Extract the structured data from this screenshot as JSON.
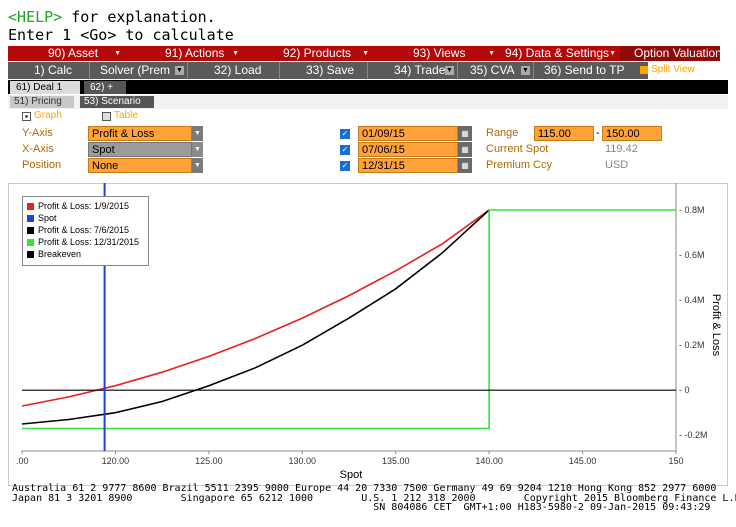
{
  "command": {
    "help_key": "<HELP>",
    "help_text": " for explanation.",
    "line2": "Enter 1 <Go> to calculate"
  },
  "menu": [
    {
      "label": "90) Asset"
    },
    {
      "label": "91) Actions"
    },
    {
      "label": "92) Products"
    },
    {
      "label": "93) Views"
    },
    {
      "label": "94) Data & Settings"
    },
    {
      "label": "Option Valuation"
    }
  ],
  "toolbar": [
    {
      "label": "1) Calc"
    },
    {
      "label": "Solver (Prem"
    },
    {
      "label": "32) Load"
    },
    {
      "label": "33) Save"
    },
    {
      "label": "34) Trade"
    },
    {
      "label": "35) CVA"
    },
    {
      "label": "36) Send to TP"
    }
  ],
  "split_view": "Split View",
  "deal_tabs": [
    {
      "label": "61) Deal 1"
    },
    {
      "label": "62) +"
    }
  ],
  "sub_tabs": [
    {
      "label": "51) Pricing"
    },
    {
      "label": "53) Scenario"
    }
  ],
  "view_mode": {
    "graph": "Graph",
    "table": "Table"
  },
  "form": {
    "y_axis": {
      "label": "Y-Axis",
      "value": "Profit & Loss"
    },
    "x_axis": {
      "label": "X-Axis",
      "value": "Spot"
    },
    "position": {
      "label": "Position",
      "value": "None"
    },
    "dates": [
      "01/09/15",
      "07/06/15",
      "12/31/15"
    ],
    "range": {
      "label": "Range",
      "from": "115.00",
      "to": "150.00"
    },
    "current_spot": {
      "label": "Current Spot",
      "value": "119.42"
    },
    "premium_ccy": {
      "label": "Premium Ccy",
      "value": "USD"
    }
  },
  "chart_data": {
    "type": "line",
    "xlabel": "Spot",
    "ylabel": "Profit & Loss",
    "xlim": [
      115,
      150
    ],
    "ylim": [
      -0.27,
      0.92
    ],
    "x_ticks": [
      ".00",
      "120.00",
      "125.00",
      "130.00",
      "135.00",
      "140.00",
      "145.00",
      "150"
    ],
    "x_tick_values": [
      115,
      120,
      125,
      130,
      135,
      140,
      145,
      150
    ],
    "y_ticks": [
      "- 0.8M",
      "- 0.6M",
      "- 0.4M",
      "- 0.2M",
      "- 0",
      "- -0.2M"
    ],
    "y_tick_values": [
      0.8,
      0.6,
      0.4,
      0.2,
      0,
      -0.2
    ],
    "spot": 119.42,
    "series": [
      {
        "name": "Profit & Loss: 1/9/2015",
        "color": "#e82020",
        "x": [
          115,
          117.5,
          120,
          122.5,
          125,
          127.5,
          130,
          132.5,
          135,
          137.5,
          140
        ],
        "y": [
          -0.07,
          -0.03,
          0.02,
          0.08,
          0.15,
          0.23,
          0.32,
          0.42,
          0.53,
          0.65,
          0.8
        ]
      },
      {
        "name": "Spot",
        "color": "#2040e0"
      },
      {
        "name": "Profit & Loss: 7/6/2015",
        "color": "#000000",
        "x": [
          115,
          117.5,
          120,
          122.5,
          125,
          127.5,
          130,
          132.5,
          135,
          137.5,
          140
        ],
        "y": [
          -0.15,
          -0.13,
          -0.1,
          -0.05,
          0.02,
          0.1,
          0.2,
          0.32,
          0.45,
          0.61,
          0.8
        ]
      },
      {
        "name": "Profit & Loss: 12/31/2015",
        "color": "#38e038",
        "x": [
          115,
          140,
          140,
          150
        ],
        "y": [
          -0.17,
          -0.17,
          0.8,
          0.8
        ]
      },
      {
        "name": "Breakeven",
        "color": "#000000",
        "x": [
          115,
          150
        ],
        "y": [
          0,
          0
        ]
      }
    ]
  },
  "footer": [
    "Australia 61 2 9777 8600 Brazil 5511 2395 9000 Europe 44 20 7330 7500 Germany 49 69 9204 1210 Hong Kong 852 2977 6000",
    "Japan 81 3 3201 8900        Singapore 65 6212 1000        U.S. 1 212 318 2000        Copyright 2015 Bloomberg Finance L.P.",
    "                                                            SN 804086 CET  GMT+1:00 H183-5980-2 09-Jan-2015 09:43:29"
  ]
}
